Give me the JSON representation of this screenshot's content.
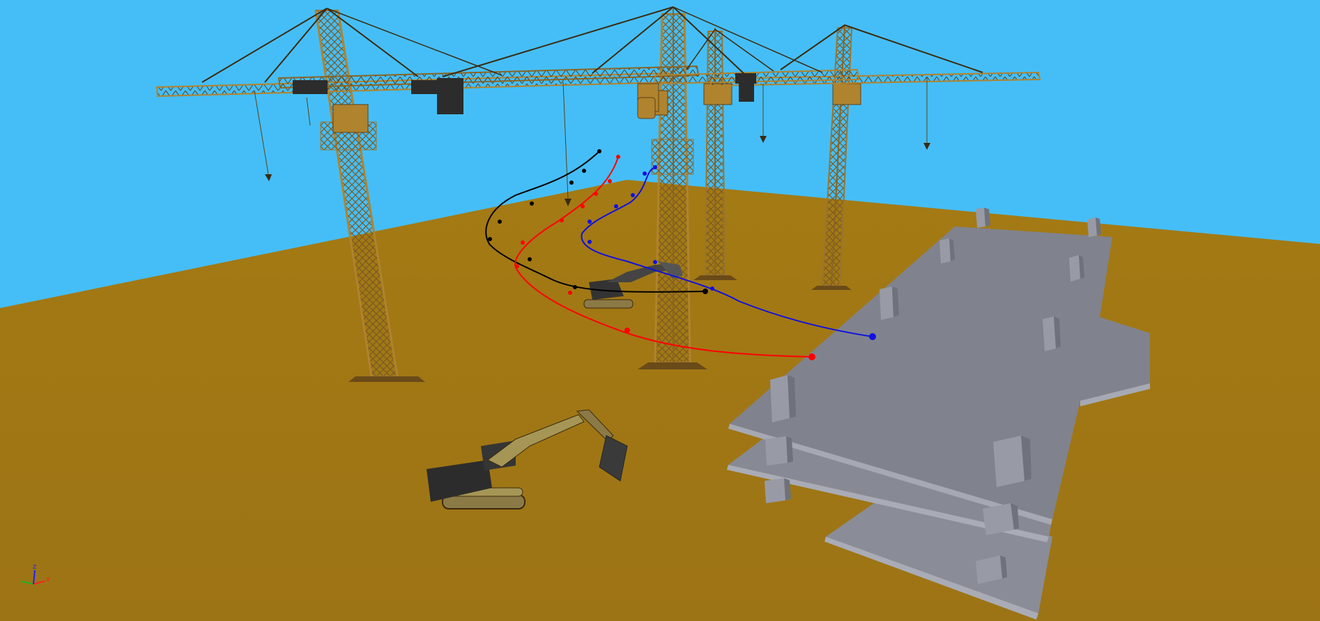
{
  "scene": {
    "colors": {
      "sky": "#45bef7",
      "ground": "#a07814",
      "ground_far": "#a47a14",
      "crane": "#b0832e",
      "crane_dark": "#6a4a18",
      "crane_cab": "#2c2c2c",
      "structure_top": "#858893",
      "structure_side": "#a6a9b4",
      "structure_shadow": "#6b6e78",
      "excavator_body": "#333333",
      "excavator_track": "#8c7a46",
      "path_black": "#000000",
      "path_red": "#ff0000",
      "path_blue": "#1010e0"
    },
    "cranes": [
      {
        "name": "tower-crane-1"
      },
      {
        "name": "tower-crane-2"
      },
      {
        "name": "tower-crane-3"
      },
      {
        "name": "tower-crane-4"
      }
    ],
    "excavators": [
      {
        "name": "excavator-near"
      },
      {
        "name": "excavator-far"
      }
    ],
    "paths": [
      {
        "name": "trajectory-black",
        "color": "#000000"
      },
      {
        "name": "trajectory-red",
        "color": "#ff0000"
      },
      {
        "name": "trajectory-blue",
        "color": "#1010e0"
      }
    ]
  },
  "axes_triad": {
    "x_label": "x",
    "y_label": "y",
    "z_label": "z",
    "x_color": "#ff2020",
    "y_color": "#20b020",
    "z_color": "#2020ff"
  }
}
